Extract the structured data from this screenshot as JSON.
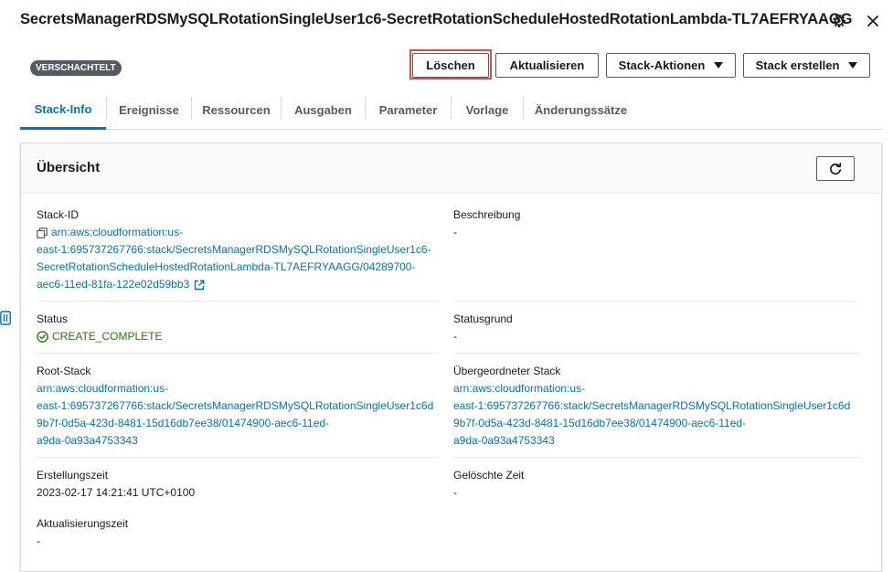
{
  "header": {
    "title": "SecretsManagerRDSMySQLRotationSingleUser1c6-SecretRotationScheduleHostedRotationLambda-TL7AEFRYAAGG"
  },
  "badge": "VERSCHACHTELT",
  "actions": {
    "delete": "Löschen",
    "update": "Aktualisieren",
    "stack_actions": "Stack-Aktionen",
    "create_stack": "Stack erstellen"
  },
  "tabs": [
    {
      "label": "Stack-Info",
      "active": true
    },
    {
      "label": "Ereignisse"
    },
    {
      "label": "Ressourcen"
    },
    {
      "label": "Ausgaben"
    },
    {
      "label": "Parameter"
    },
    {
      "label": "Vorlage"
    },
    {
      "label": "Änderungssätze"
    }
  ],
  "overview": {
    "title": "Übersicht",
    "stack_id": {
      "label": "Stack-ID",
      "line1": "arn:aws:cloudformation:us-",
      "line2": "east-1:695737267766:stack/SecretsManagerRDSMySQLRotationSingleUser1c6-",
      "line3": "SecretRotationScheduleHostedRotationLambda-TL7AEFRYAAGG/04289700-",
      "line4": "aec6-11ed-81fa-122e02d59bb3"
    },
    "description": {
      "label": "Beschreibung",
      "value": "-"
    },
    "status": {
      "label": "Status",
      "value": "CREATE_COMPLETE"
    },
    "status_reason": {
      "label": "Statusgrund",
      "value": "-"
    },
    "root_stack": {
      "label": "Root-Stack",
      "line1": "arn:aws:cloudformation:us-",
      "line2": "east-1:695737267766:stack/SecretsManagerRDSMySQLRotationSingleUser1c6d",
      "line3": "9b7f-0d5a-423d-8481-15d16db7ee38/01474900-aec6-11ed-",
      "line4": "a9da-0a93a4753343"
    },
    "parent_stack": {
      "label": "Übergeordneter Stack",
      "line1": "arn:aws:cloudformation:us-",
      "line2": "east-1:695737267766:stack/SecretsManagerRDSMySQLRotationSingleUser1c6d",
      "line3": "9b7f-0d5a-423d-8481-15d16db7ee38/01474900-aec6-11ed-",
      "line4": "a9da-0a93a4753343"
    },
    "created": {
      "label": "Erstellungszeit",
      "value": "2023-02-17 14:21:41 UTC+0100"
    },
    "deleted": {
      "label": "Gelöschte Zeit",
      "value": "-"
    },
    "updated": {
      "label": "Aktualisierungszeit",
      "value": "-"
    }
  },
  "colors": {
    "link": "#0073bb",
    "success": "#1d8102",
    "highlight": "#e04d3a",
    "badge_bg": "#545b64"
  },
  "icons": [
    "settings-icon",
    "close-icon",
    "copy-icon",
    "external-link-icon",
    "check-circle-icon",
    "refresh-icon",
    "caret-down-icon",
    "side-panel-icon"
  ]
}
